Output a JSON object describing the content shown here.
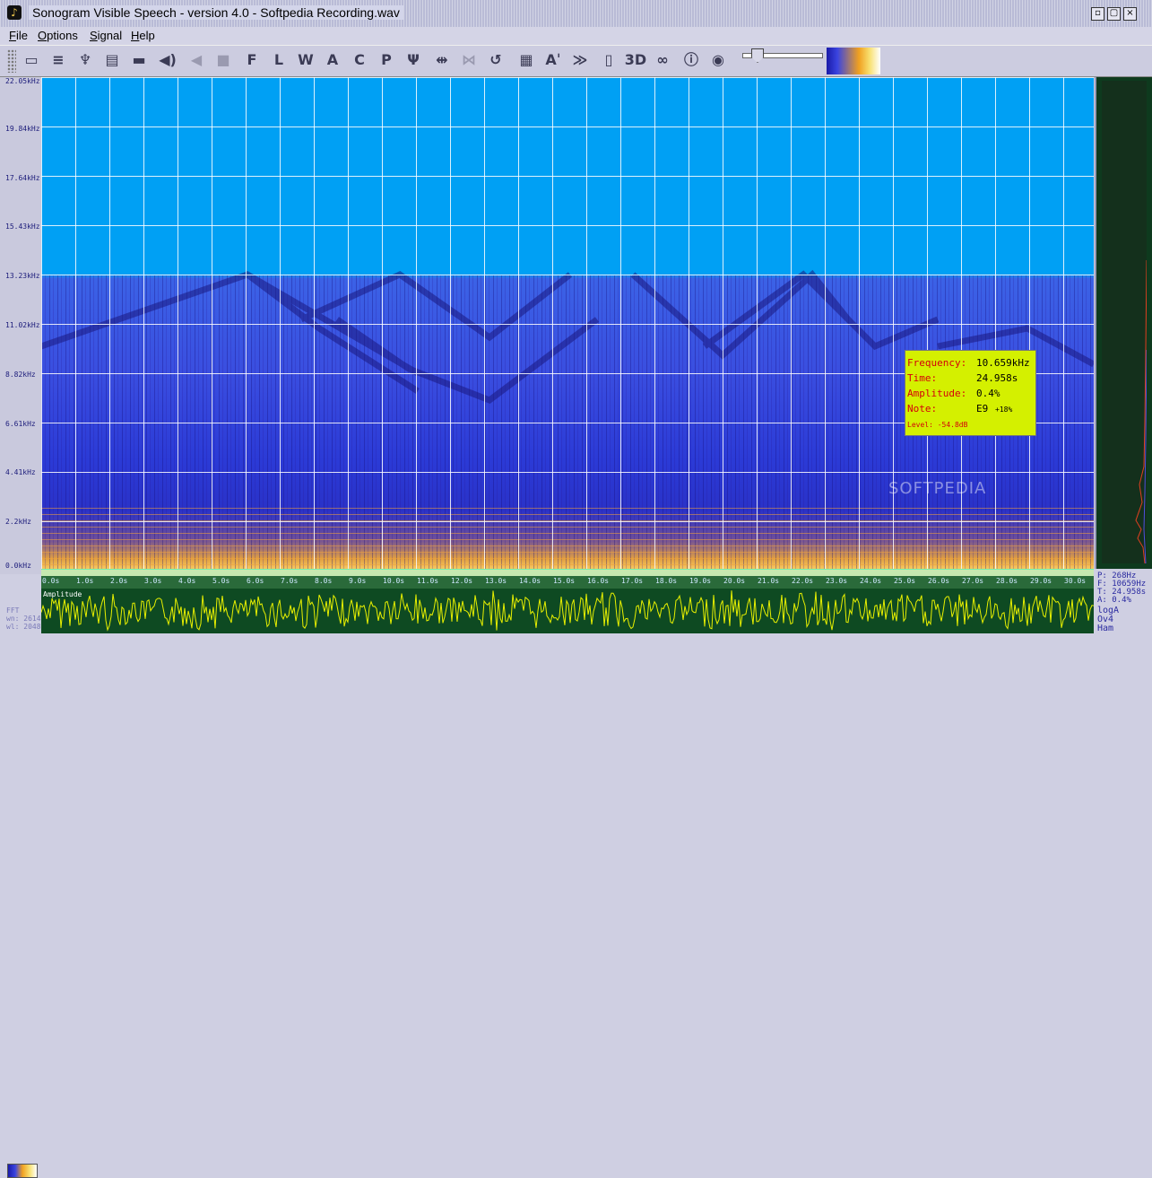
{
  "window": {
    "title": "Sonogram Visible Speech - version 4.0 - Softpedia Recording.wav"
  },
  "menu": [
    "File",
    "Options",
    "Signal",
    "Help"
  ],
  "toolbar": {
    "buttons": [
      {
        "name": "open-icon",
        "glyph": "▭"
      },
      {
        "name": "settings-icon",
        "glyph": "≡"
      },
      {
        "name": "microphone-icon",
        "glyph": "♆"
      },
      {
        "name": "layout-icon",
        "glyph": "▤"
      },
      {
        "name": "display-icon",
        "glyph": "▬"
      },
      {
        "name": "speaker-icon",
        "glyph": "◀)"
      },
      {
        "name": "rewind-icon",
        "glyph": "◀"
      },
      {
        "name": "stop-icon",
        "glyph": "■"
      },
      {
        "name": "letter-f-icon",
        "glyph": "F"
      },
      {
        "name": "letter-l-icon",
        "glyph": "L"
      },
      {
        "name": "letter-w-icon",
        "glyph": "W"
      },
      {
        "name": "letter-a-icon",
        "glyph": "A"
      },
      {
        "name": "letter-c-icon",
        "glyph": "C"
      },
      {
        "name": "letter-p-icon",
        "glyph": "P"
      },
      {
        "name": "psi-icon",
        "glyph": "Ψ"
      },
      {
        "name": "zoom-fit-icon",
        "glyph": "⇹"
      },
      {
        "name": "zoom-range-icon",
        "glyph": "⋈"
      },
      {
        "name": "undo-icon",
        "glyph": "↺"
      },
      {
        "name": "grid-icon",
        "glyph": "▦"
      },
      {
        "name": "font-icon",
        "glyph": "Aˈ"
      },
      {
        "name": "export-icon",
        "glyph": "≫"
      },
      {
        "name": "page-icon",
        "glyph": "▯"
      },
      {
        "name": "3d-icon",
        "glyph": "3D"
      },
      {
        "name": "binoculars-icon",
        "glyph": "∞"
      },
      {
        "name": "info-icon",
        "glyph": "ⓘ"
      },
      {
        "name": "about-icon",
        "glyph": "◉"
      }
    ]
  },
  "y_axis": {
    "labels": [
      "22.05kHz",
      "19.84kHz",
      "17.64kHz",
      "15.43kHz",
      "13.23kHz",
      "11.02kHz",
      "8.82kHz",
      "6.61kHz",
      "4.41kHz",
      "2.2kHz",
      "0.0kHz"
    ]
  },
  "time_axis": {
    "labels": [
      "0.0s",
      "1.0s",
      "2.0s",
      "3.0s",
      "4.0s",
      "5.0s",
      "6.0s",
      "7.0s",
      "8.0s",
      "9.0s",
      "10.0s",
      "11.0s",
      "12.0s",
      "13.0s",
      "14.0s",
      "15.0s",
      "16.0s",
      "17.0s",
      "18.0s",
      "19.0s",
      "20.0s",
      "21.0s",
      "22.0s",
      "23.0s",
      "24.0s",
      "25.0s",
      "26.0s",
      "27.0s",
      "28.0s",
      "29.0s",
      "30.0s"
    ]
  },
  "readout": {
    "frequency_label": "Frequency:",
    "frequency_value": "10.659kHz",
    "time_label": "Time:",
    "time_value": "24.958s",
    "amplitude_label": "Amplitude:",
    "amplitude_value": "0.4%",
    "note_label": "Note:",
    "note_value": "E9",
    "note_cents": "+18%",
    "level_text": "Level: -54.8dB"
  },
  "watermark": "SOFTPEDIA",
  "waveform": {
    "label": "Amplitude"
  },
  "bottom_left": {
    "fft": "FFT",
    "wn": "wn: 2614",
    "wl": "wl: 2048"
  },
  "info_box": {
    "p": "P: 268Hz",
    "f": "F: 10659Hz",
    "t": "T: 24.958s",
    "a": "A: 0.4%",
    "scale": "logA",
    "ov": "Ov4",
    "window": "Ham"
  },
  "colors": {
    "background_blue": "#00a0f4",
    "spectrum_dark": "#2a32c8",
    "highlight": "#d4f000",
    "waveform": "#e8f000"
  }
}
